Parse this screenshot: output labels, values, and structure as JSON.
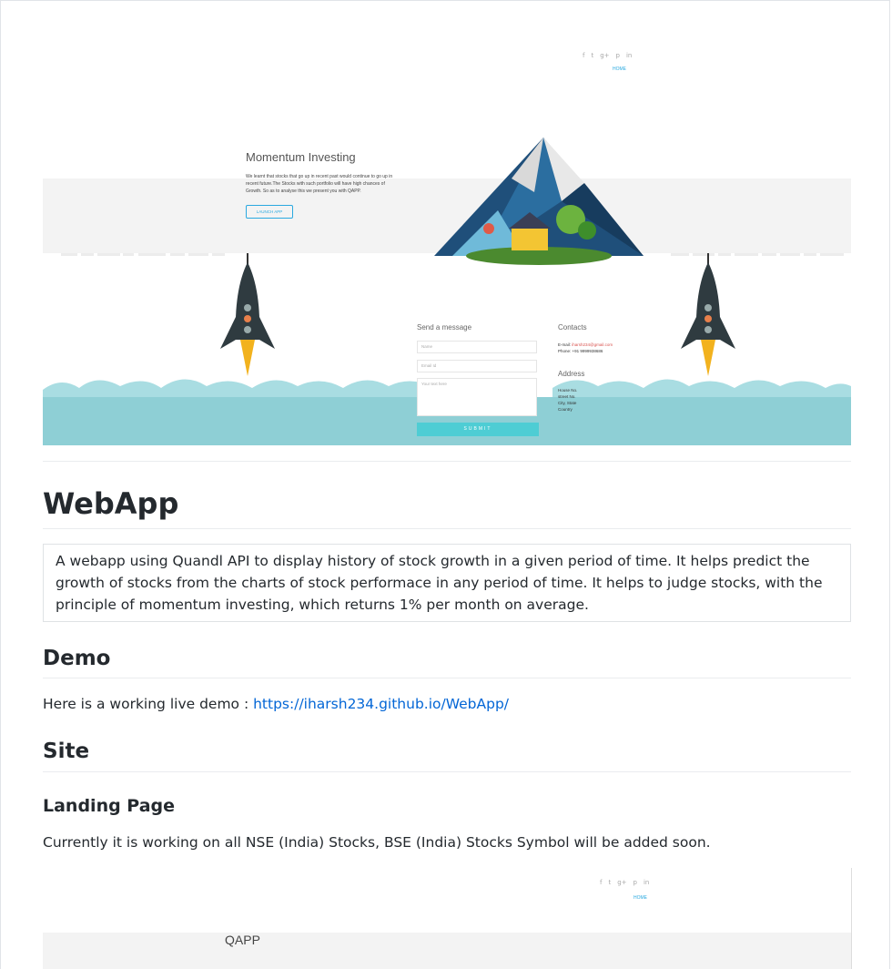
{
  "hero_shot": {
    "social_icons": [
      "f",
      "t",
      "g+",
      "p",
      "in"
    ],
    "nav_home": "HOME",
    "title": "Momentum Investing",
    "text": "We learnt that stocks that go up in recent past would continue to go up in recent future.The Stocks with such portfolio will have high chances of Growth. So as to analyse this we present you with QAPP.",
    "button": "LAUNCH APP",
    "form": {
      "title": "Send a message",
      "name_placeholder": "Name",
      "email_placeholder": "Email Id",
      "text_placeholder": "Your text here",
      "submit": "SUBMIT"
    },
    "contacts": {
      "title": "Contacts",
      "email_label": "E-mail:",
      "email": "iharsh234@gmail.com",
      "phone": "Phone: +91 9999938686"
    },
    "address": {
      "title": "Address",
      "lines": [
        "House No.",
        "street No.",
        "City, State",
        "Country"
      ]
    },
    "colors": {
      "cloud": "#8ecfd5",
      "accent": "#4ecdd4",
      "link": "#2aa9e0"
    }
  },
  "readme": {
    "title": "WebApp",
    "description": "A webapp using Quandl API to display history of stock growth in a given period of time. It helps predict the growth of stocks from the charts of stock performace in any period of time. It helps to judge stocks, with the principle of momentum investing, which returns 1% per month on average.",
    "demo_heading": "Demo",
    "demo_text": "Here is a working live demo : ",
    "demo_link": "https://iharsh234.github.io/WebApp/",
    "site_heading": "Site",
    "landing_heading": "Landing Page",
    "landing_text": "Currently it is working on all NSE (India) Stocks, BSE (India) Stocks Symbol will be added soon."
  },
  "landing_shot": {
    "social_icons": [
      "f",
      "t",
      "g+",
      "p",
      "in"
    ],
    "nav_home": "HOME",
    "title": "QAPP"
  }
}
